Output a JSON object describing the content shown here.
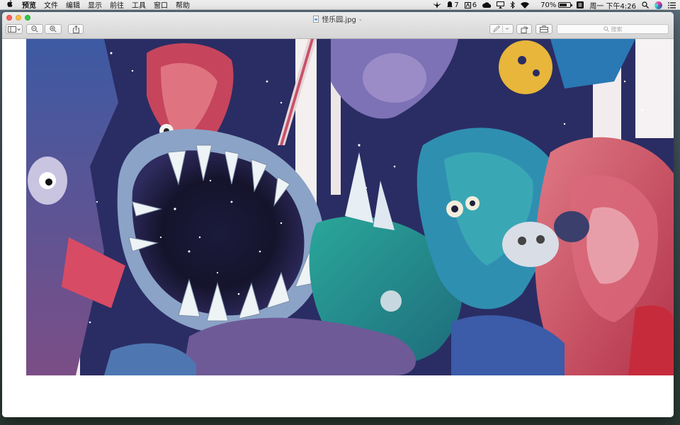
{
  "menubar": {
    "apple_icon": "apple-icon",
    "app_name": "预览",
    "menus": [
      "文件",
      "编辑",
      "显示",
      "前往",
      "工具",
      "窗口",
      "帮助"
    ],
    "status": {
      "notification_count": "7",
      "adobe_count": "6",
      "battery": "70%",
      "battery_level": 0.7,
      "clock": "周一 下午4:26"
    }
  },
  "window": {
    "title": "怪乐园.jpg",
    "search_placeholder": "搜索",
    "toolbar_icons": [
      "sidebar-icon",
      "zoom-out-icon",
      "zoom-in-icon",
      "share-icon",
      "markup-pen-icon",
      "rotate-icon",
      "toolbox-icon",
      "search-icon"
    ]
  },
  "colors": {
    "close": "#fc605c",
    "minimize": "#fdbc40",
    "maximize": "#34c84a"
  }
}
